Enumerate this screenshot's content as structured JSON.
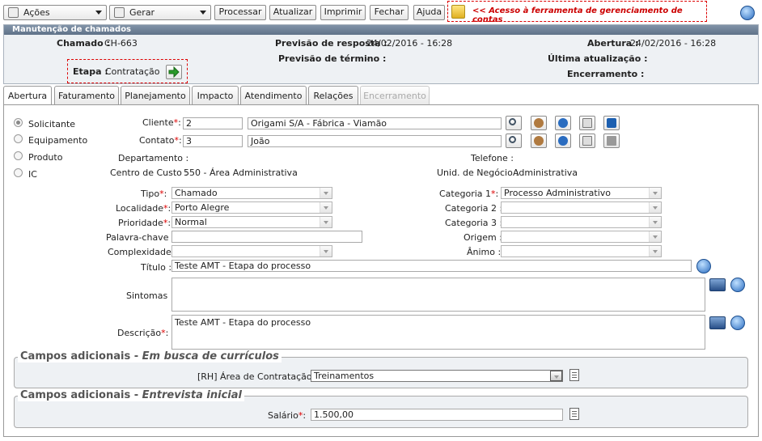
{
  "toolbar": {
    "acoes": "Ações",
    "gerar": "Gerar",
    "processar": "Processar",
    "atualizar": "Atualizar",
    "imprimir": "Imprimir",
    "fechar": "Fechar",
    "ajuda": "Ajuda",
    "note": "<< Acesso à ferramenta de gerenciamento de contas"
  },
  "panel": {
    "title": "Manutenção de chamados",
    "chamado_label": "Chamado :",
    "chamado_value": "CH-663",
    "prev_resp_label": "Previsão de resposta :",
    "prev_resp_value": "24/02/2016 - 16:28",
    "abertura_label": "Abertura :",
    "abertura_value": "24/02/2016 - 16:28",
    "prev_term_label": "Previsão de término :",
    "prev_term_value": "-",
    "ultima_label": "Última atualização :",
    "etapa_label": "Etapa :",
    "etapa_value": "Contratação",
    "encerramento_label": "Encerramento :"
  },
  "tabs": [
    "Abertura",
    "Faturamento",
    "Planejamento",
    "Impacto",
    "Atendimento",
    "Relações",
    "Encerramento"
  ],
  "radios": [
    "Solicitante",
    "Equipamento",
    "Produto",
    "IC"
  ],
  "form": {
    "cliente_label": "Cliente",
    "cliente_code": "2",
    "cliente_name": "Origami S/A - Fábrica - Viamão",
    "contato_label": "Contato",
    "contato_code": "3",
    "contato_name": "João",
    "departamento_label": "Departamento :",
    "telefone_label": "Telefone :",
    "centro_label": "Centro de Custo :",
    "centro_value": "550 - Área Administrativa",
    "unid_label": "Unid. de Negócio :",
    "unid_value": "Administrativa",
    "tipo_label": "Tipo",
    "tipo_value": "Chamado",
    "localidade_label": "Localidade",
    "localidade_value": "Porto Alegre",
    "prioridade_label": "Prioridade",
    "prioridade_value": "Normal",
    "palavra_label": "Palavra-chave :",
    "complexidade_label": "Complexidade :",
    "cat1_label": "Categoria 1",
    "cat1_value": "Processo Administrativo",
    "cat2_label": "Categoria 2 :",
    "cat3_label": "Categoria 3 :",
    "origem_label": "Origem :",
    "animo_label": "Ânimo :",
    "titulo_label": "Título :",
    "titulo_value": "Teste AMT - Etapa do processo",
    "sintomas_label": "Sintomas :",
    "descricao_label": "Descrição",
    "descricao_value": "Teste AMT - Etapa do processo"
  },
  "extra1": {
    "legend_a": "Campos adicionais - ",
    "legend_b": "Em busca de currículos",
    "label": "[RH] Área de Contratação :",
    "value": "Treinamentos"
  },
  "extra2": {
    "legend_a": "Campos adicionais - ",
    "legend_b": "Entrevista inicial",
    "label": "Salário",
    "value": "1.500,00"
  }
}
